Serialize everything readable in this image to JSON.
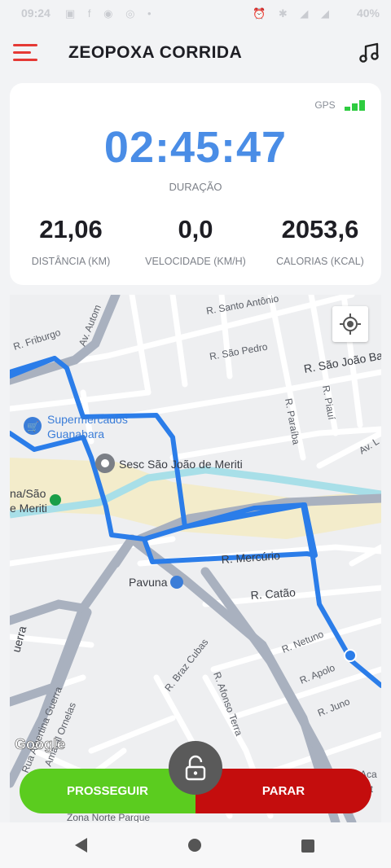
{
  "status_bar": {
    "time": "09:24",
    "battery": "40%"
  },
  "header": {
    "title": "ZEOPOXA CORRIDA"
  },
  "stats": {
    "gps_label": "GPS",
    "duration": "02:45:47",
    "duration_label": "DURAÇÃO",
    "distance": "21,06",
    "distance_label": "DISTÂNCIA (KM)",
    "speed": "0,0",
    "speed_label": "VELOCIDADE (KM/H)",
    "calories": "2053,6",
    "calories_label": "CALORIAS (KCAL)"
  },
  "map": {
    "streets": {
      "santo_antonio": "R. Santo Antônio",
      "friburgo": "R. Friburgo",
      "av_automovel": "Av. Autom",
      "sao_pedro": "R. São Pedro",
      "sao_joao": "R. São João Ba",
      "paraiba": "R. Paraíba",
      "piaui": "R. Piauí",
      "av_l": "Av. L",
      "mercurio": "R. Mercúrio",
      "catao": "R. Catão",
      "netuno": "R. Netuno",
      "apolo": "R. Apolo",
      "juno": "R. Juno",
      "braz_cubas": "R. Braz Cubas",
      "afonso_terra": "R. Afonso Terra",
      "albertina_guerra": "Rua Albertina Guerra",
      "amaral_ornelas": "Amaral Ornelas",
      "guerra": "uerra",
      "zona_norte": "Zona Norte Parque"
    },
    "places": {
      "supermercados_1": "Supermercados",
      "supermercados_2": "Guanabara",
      "sesc": "Sesc São João de Meriti",
      "station_1": "na/São",
      "station_2": "e Meriti",
      "pavuna": "Pavuna",
      "aca_1": "Aca",
      "aca_2": "ert"
    },
    "attribution": "Google"
  },
  "actions": {
    "continue_label": "PROSSEGUIR",
    "stop_label": "PARAR"
  },
  "colors": {
    "accent_blue": "#4a8de6",
    "go_green": "#5bcc1f",
    "stop_red": "#c40d0d",
    "menu_red": "#e53935",
    "route_blue": "#2b7de9"
  }
}
